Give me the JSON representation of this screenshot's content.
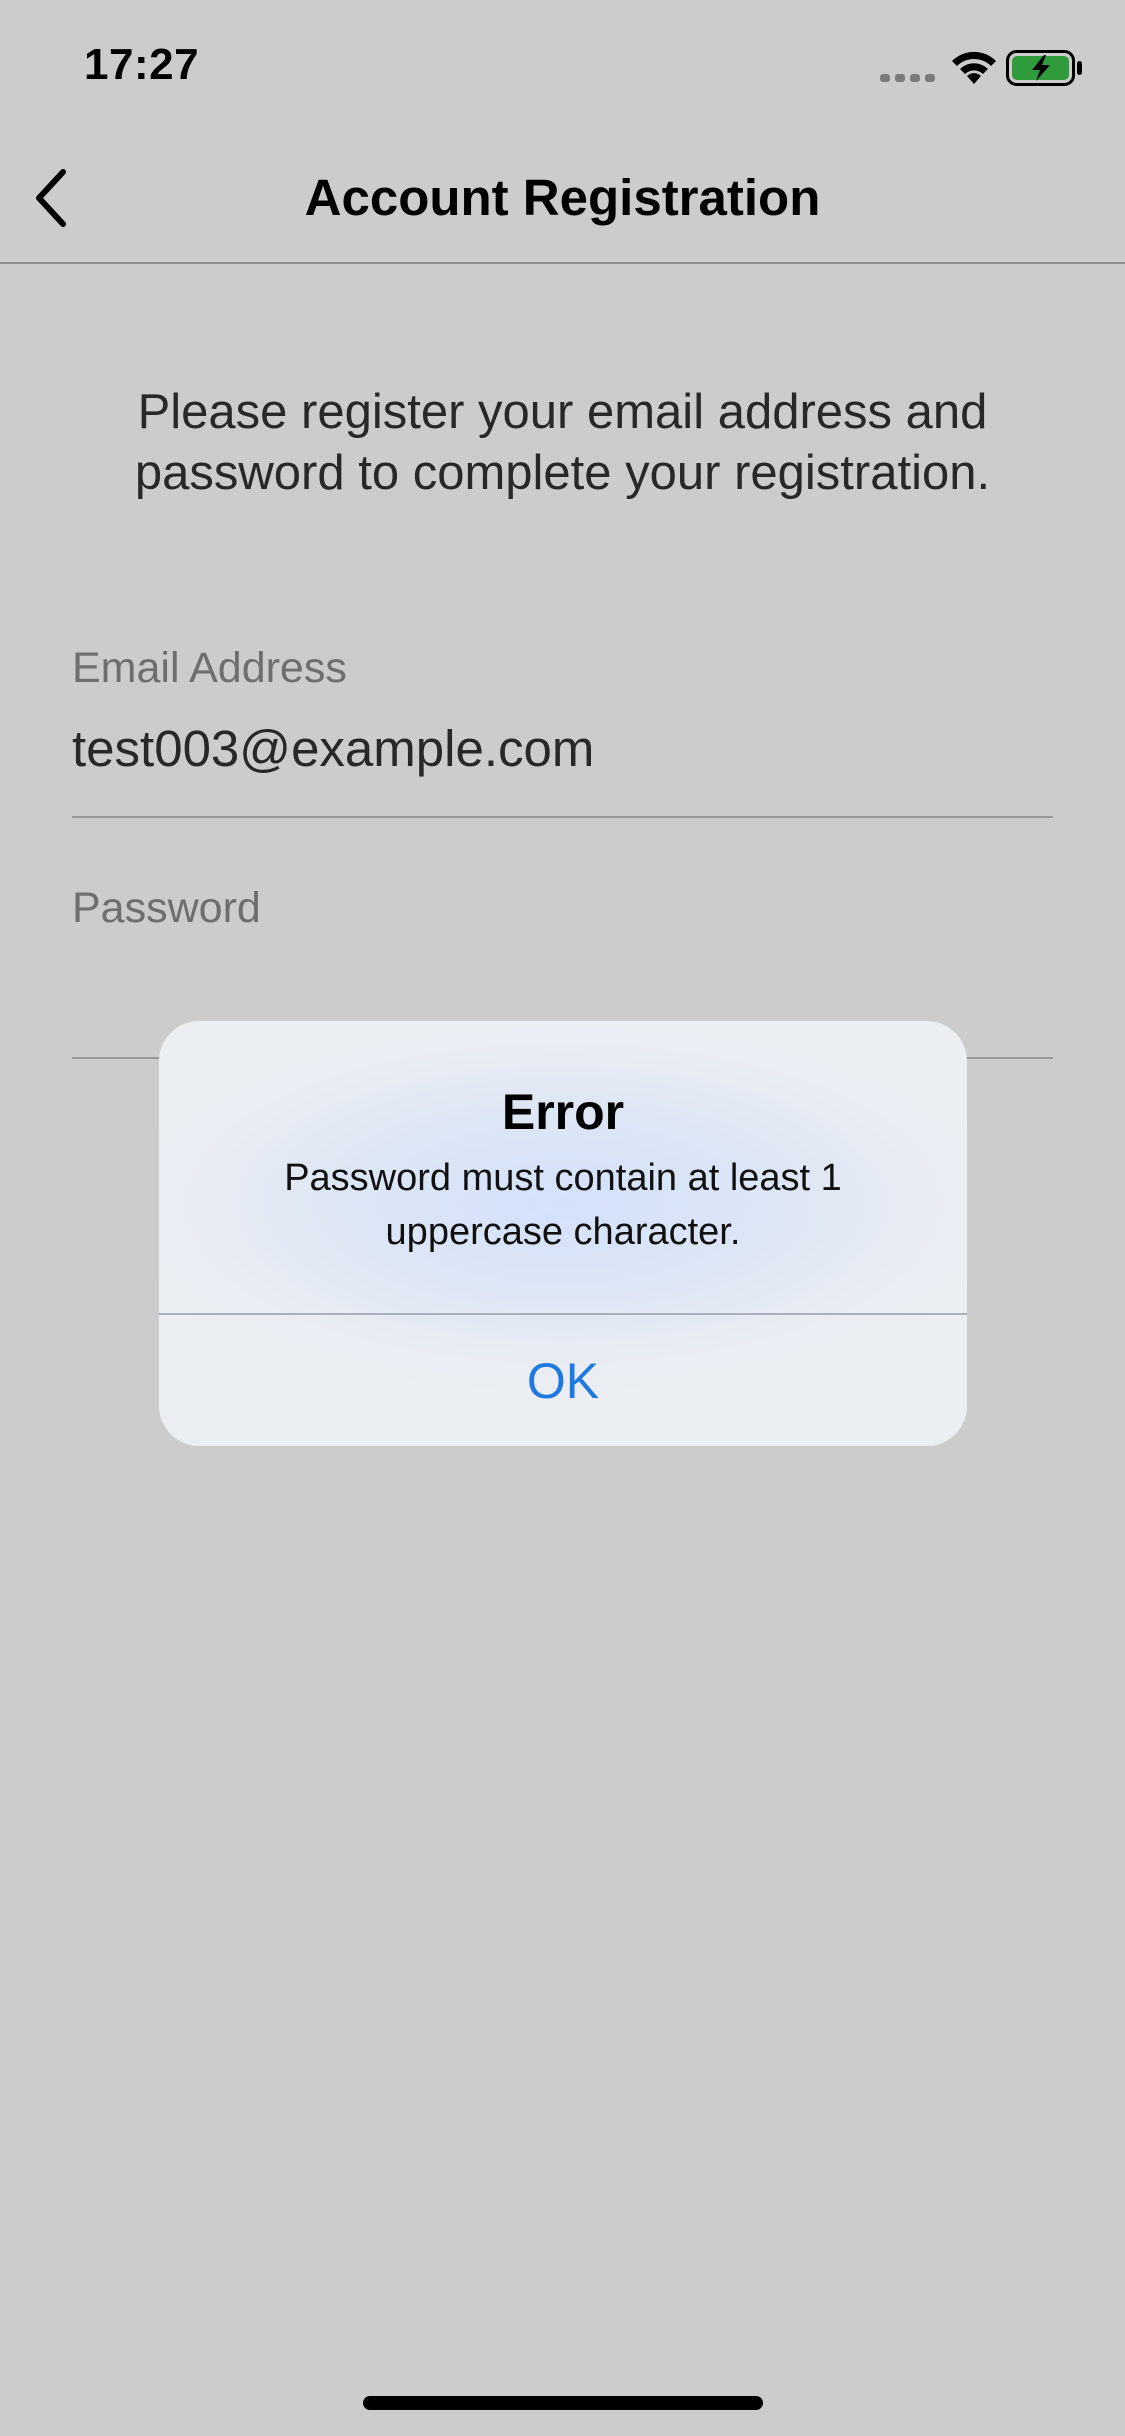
{
  "status_bar": {
    "time": "17:27",
    "icons": [
      "cellular-signal-icon",
      "wifi-icon",
      "battery-charging-icon"
    ],
    "battery_color": "#3cc24a"
  },
  "nav": {
    "title": "Account Registration",
    "back_icon": "chevron-left-icon"
  },
  "main": {
    "intro": "Please register your email address and password to complete your registration.",
    "email": {
      "label": "Email Address",
      "value": "test003@example.com"
    },
    "password": {
      "label": "Password",
      "value": ""
    }
  },
  "alert": {
    "title": "Error",
    "message": "Password must contain at least 1 uppercase character.",
    "ok_label": "OK",
    "button_color": "#1f7ae0"
  },
  "colors": {
    "background": "#ffffff",
    "dimmed_background": "#cecece",
    "accent": "#1f7ae0"
  }
}
